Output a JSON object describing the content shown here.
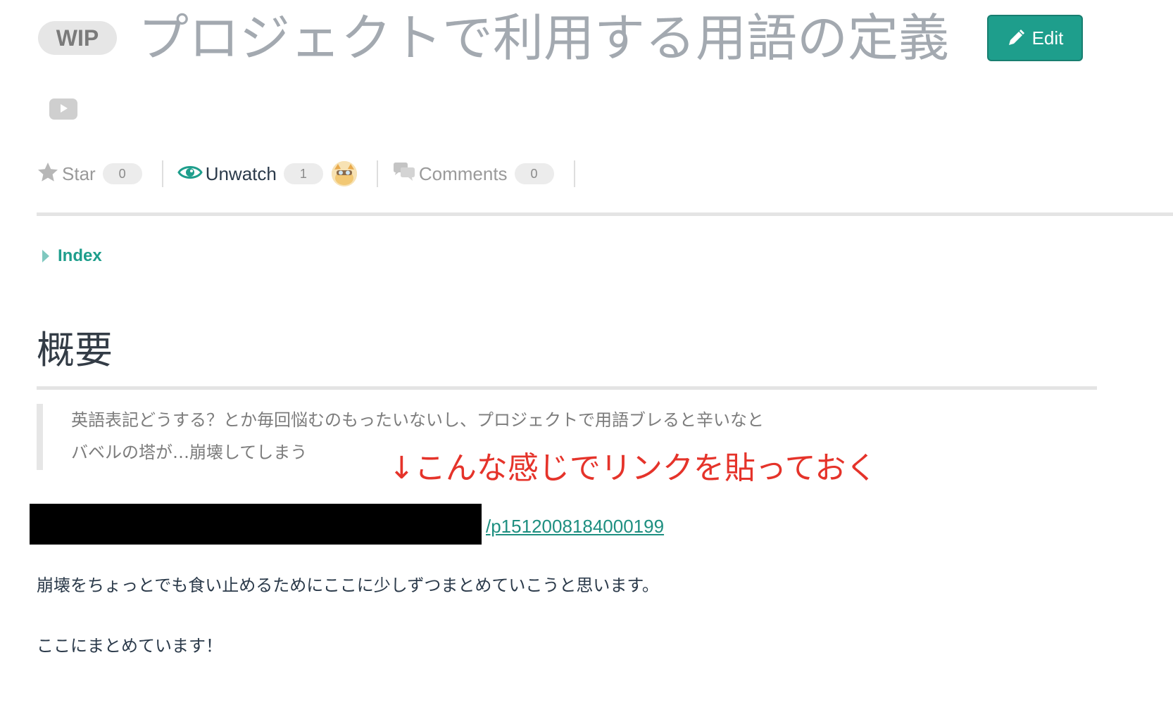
{
  "header": {
    "status_badge": "WIP",
    "title": "プロジェクトで利用する用語の定義",
    "edit_label": "Edit"
  },
  "meta": {
    "star_label": "Star",
    "star_count": "0",
    "watch_label": "Unwatch",
    "watch_count": "1",
    "comments_label": "Comments",
    "comments_count": "0"
  },
  "toc": {
    "label": "Index"
  },
  "content": {
    "heading": "概要",
    "quote_lines": [
      "英語表記どうする？とか毎回悩むのもったいないし、プロジェクトで用語ブレると辛いなと",
      "バベルの塔が…崩壊してしまう"
    ],
    "annotation": "↓こんな感じでリンクを貼っておく",
    "link_text": "/p1512008184000199",
    "paragraph_1": "崩壊をちょっとでも食い止めるためにここに少しずつまとめていこうと思います。",
    "paragraph_2": "ここにまとめています！"
  },
  "colors": {
    "accent": "#1e9e8c",
    "annotation": "#e5332a",
    "title": "#a3a9b0"
  },
  "icons": [
    "pencil-icon",
    "video-play-icon",
    "star-icon",
    "eye-icon",
    "comments-icon",
    "index-caret-icon"
  ]
}
